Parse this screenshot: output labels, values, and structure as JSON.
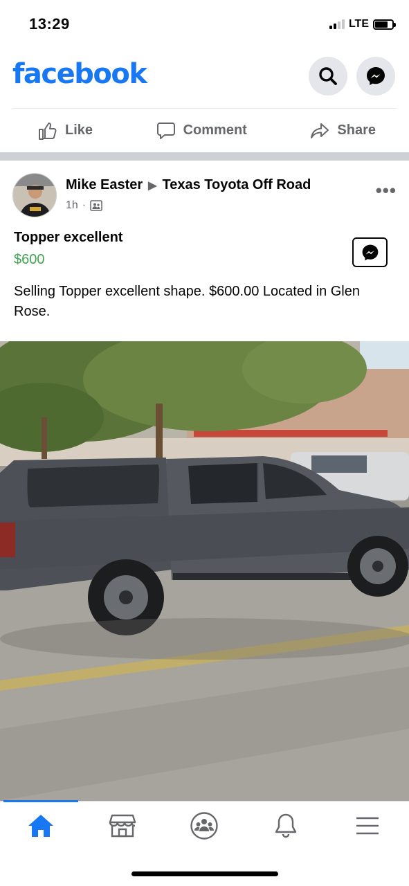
{
  "status_bar": {
    "time": "13:29",
    "network": "LTE",
    "battery_level": 0.75,
    "signal_bars": 2
  },
  "header": {
    "logo": "facebook",
    "search_icon": "search-icon",
    "messenger_icon": "messenger-icon"
  },
  "actions": {
    "like": "Like",
    "comment": "Comment",
    "share": "Share"
  },
  "post": {
    "author": "Mike Easter",
    "group": "Texas Toyota Off Road",
    "time": "1h",
    "separator": "·",
    "audience_icon": "group-icon",
    "more": "•••",
    "listing_title": "Topper excellent",
    "price": "$600",
    "body": "Selling Topper excellent shape. $600.00 Located in Glen Rose.",
    "photo_icon": "photo-of-gray-pickup-truck-with-topper"
  },
  "colors": {
    "brand": "#1877f2",
    "price": "#42a452",
    "muted": "#65676b"
  },
  "bottom_nav": {
    "items": [
      {
        "name": "home-icon",
        "active": true
      },
      {
        "name": "marketplace-icon",
        "active": false
      },
      {
        "name": "groups-icon",
        "active": false
      },
      {
        "name": "notifications-icon",
        "active": false
      },
      {
        "name": "menu-icon",
        "active": false
      }
    ]
  }
}
